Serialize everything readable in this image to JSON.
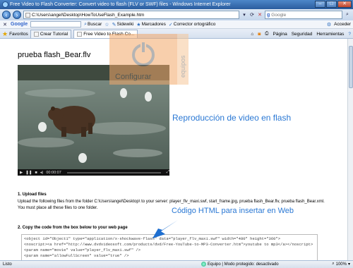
{
  "window": {
    "title": "Free Video to Flash Converter: Convert video to flash (FLV or SWF) files - Windows Internet Explorer"
  },
  "address_bar": {
    "url": "C:\\Users\\angel\\Desktop\\HowToUseFlash_Example.htm",
    "search_placeholder": "Google"
  },
  "google_toolbar": {
    "logo": "Google",
    "items": [
      "Buscar",
      "Sidewiki",
      "Marcadores",
      "Corrector ortográfico"
    ],
    "right_label": "Acceder"
  },
  "tabs_bar": {
    "favorites_label": "Favoritos",
    "tabs": [
      "Crear Tutorial",
      "Free Video to Flash Co..."
    ],
    "commands": [
      "Página",
      "Seguridad",
      "Herramientas"
    ]
  },
  "page": {
    "title": "prueba flash_Bear.flv",
    "video_time": "00:00:07",
    "overlay_video": "Reproducción de video en flash",
    "overlay_html": "Código HTML para insertar en Web",
    "upload_heading": "1. Upload files",
    "upload_text": "Upload the following files from the folder C:\\Users\\angel\\Desktop\\ to your server: player_flv_maxi.swf, start_frame.jpg, prueba flash_Bear.flv, prueba flash_Bear.xml. You must place all these files to one folder.",
    "copy_heading": "2. Copy the code from the box below to your web page",
    "code_lines": [
      "<object id=\"Object1\" type=\"application/x-shockwave-flash\" data=\"player_flv_maxi.swf\" width=\"480\" height=\"360\">",
      "<noscript><a href=\"http://www.dvdvideosoft.com/products/dvd/Free-YouTube-to-MP3-Converter.htm\">youtube to mp3</a></noscript>",
      "<param name=\"movie\" value=\"player_flv_maxi.swf\" />",
      "<param name=\"allowFullScreen\" value=\"true\" />"
    ]
  },
  "watermark": {
    "text": "Configurar",
    "side_text": "equipos"
  },
  "status_bar": {
    "left": "Listo",
    "zone": "Equipo | Modo protegido: desactivado",
    "zoom": "100%"
  }
}
